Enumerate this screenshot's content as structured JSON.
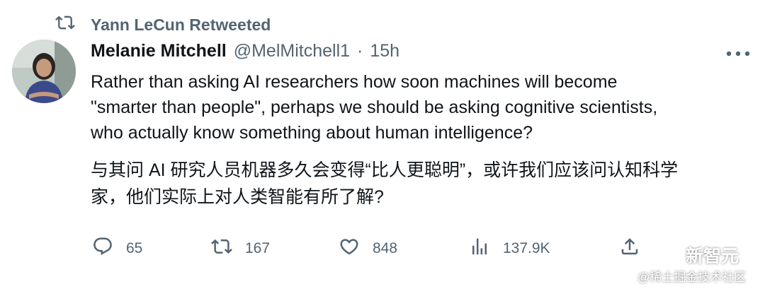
{
  "retweet": {
    "icon": "retweet-icon",
    "label": "Yann LeCun Retweeted"
  },
  "author": {
    "name": "Melanie Mitchell",
    "handle": "@MelMitchell1",
    "separator": "·",
    "time": "15h"
  },
  "tweet": {
    "lines": [
      "Rather than asking AI researchers how soon machines will become",
      "\"smarter than people\", perhaps we should be asking cognitive scientists,",
      "who actually know something about human intelligence?"
    ]
  },
  "translation": {
    "lines": [
      "与其问 AI 研究人员机器多久会变得“比人更聪明”，或许我们应该问认知科学",
      "家，他们实际上对人类智能有所了解?"
    ]
  },
  "actions": {
    "replies": "65",
    "retweets": "167",
    "likes": "848",
    "views": "137.9K"
  },
  "watermark": {
    "brand": "新智元",
    "source": "@稀土掘金技术社区"
  },
  "colors": {
    "text_primary": "#0f1419",
    "text_secondary": "#536471"
  }
}
